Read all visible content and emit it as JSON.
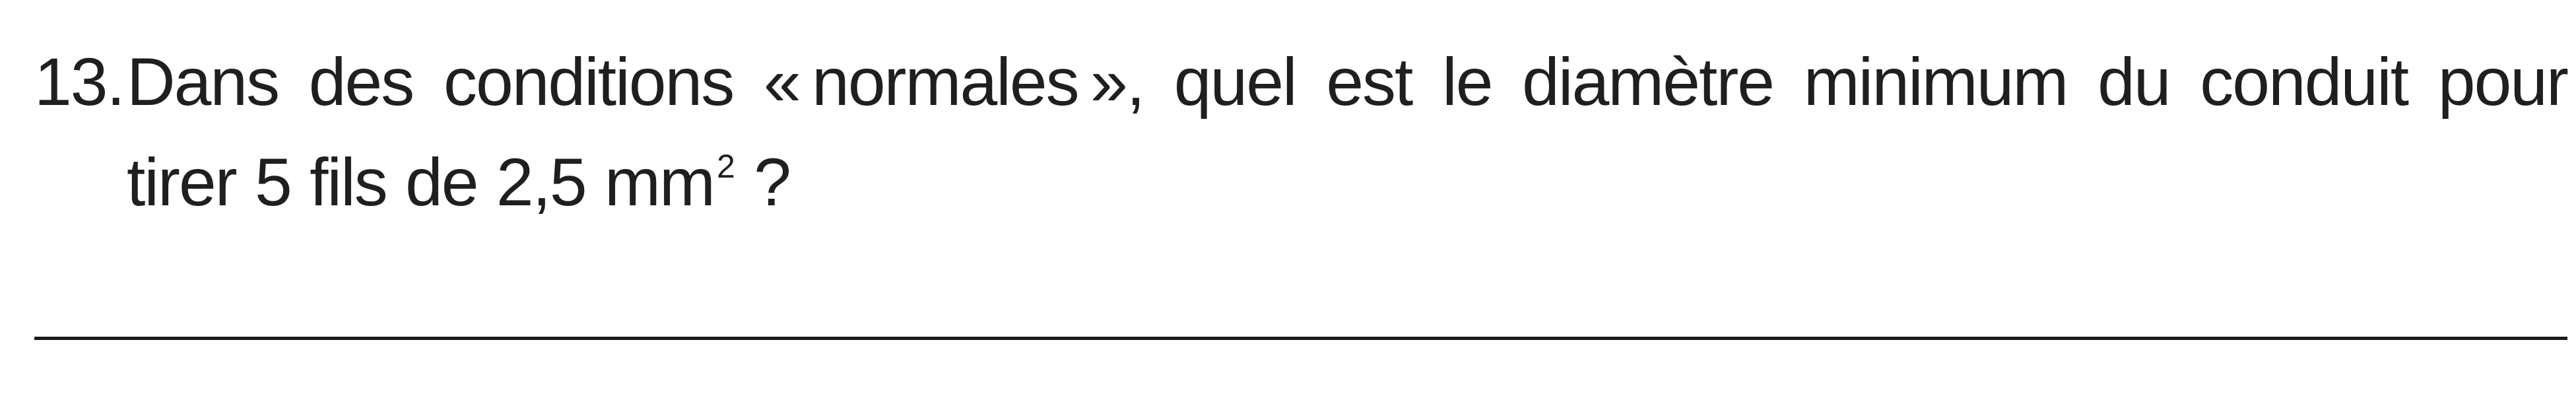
{
  "question": {
    "number": "13.",
    "text_main": "Dans des conditions « normales », quel est le diamètre minimum du conduit pour tirer 5 fils de 2,5 mm",
    "exponent": "2",
    "text_end": " ?"
  }
}
